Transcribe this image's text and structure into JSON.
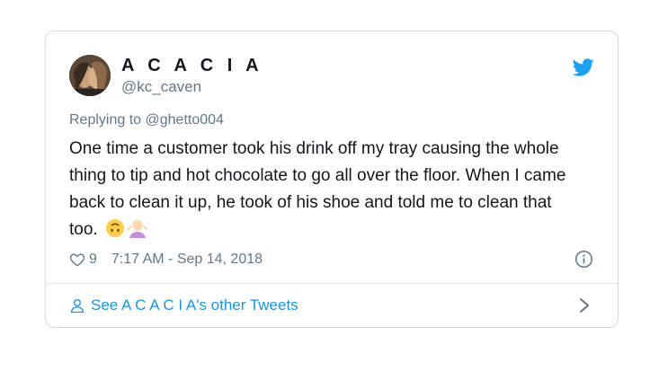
{
  "tweet": {
    "display_name": "A C A C I A",
    "handle": "@kc_caven",
    "reply_prefix": "Replying to",
    "reply_to": "@ghetto004",
    "text": "One time a customer took his drink off my tray causing the whole thing to tip and hot chocolate to go all over the floor. When I came back to clean it up, he took of his shoe and told me to clean that too.",
    "like_count": "9",
    "timestamp": "7:17 AM - Sep 14, 2018",
    "footer_link": "See A C A C I A's other Tweets"
  },
  "icons": {
    "brand": "twitter-bird-icon",
    "like": "heart-icon",
    "info": "info-icon",
    "profile": "person-icon",
    "chevron": "chevron-right-icon",
    "emoji_1": "upside-down-face-emoji",
    "emoji_2": "woman-shrugging-emoji"
  },
  "colors": {
    "twitter_blue": "#1da1f2",
    "link_blue": "#1b95e0",
    "muted_gray": "#657786",
    "border": "#d3dbe2"
  }
}
